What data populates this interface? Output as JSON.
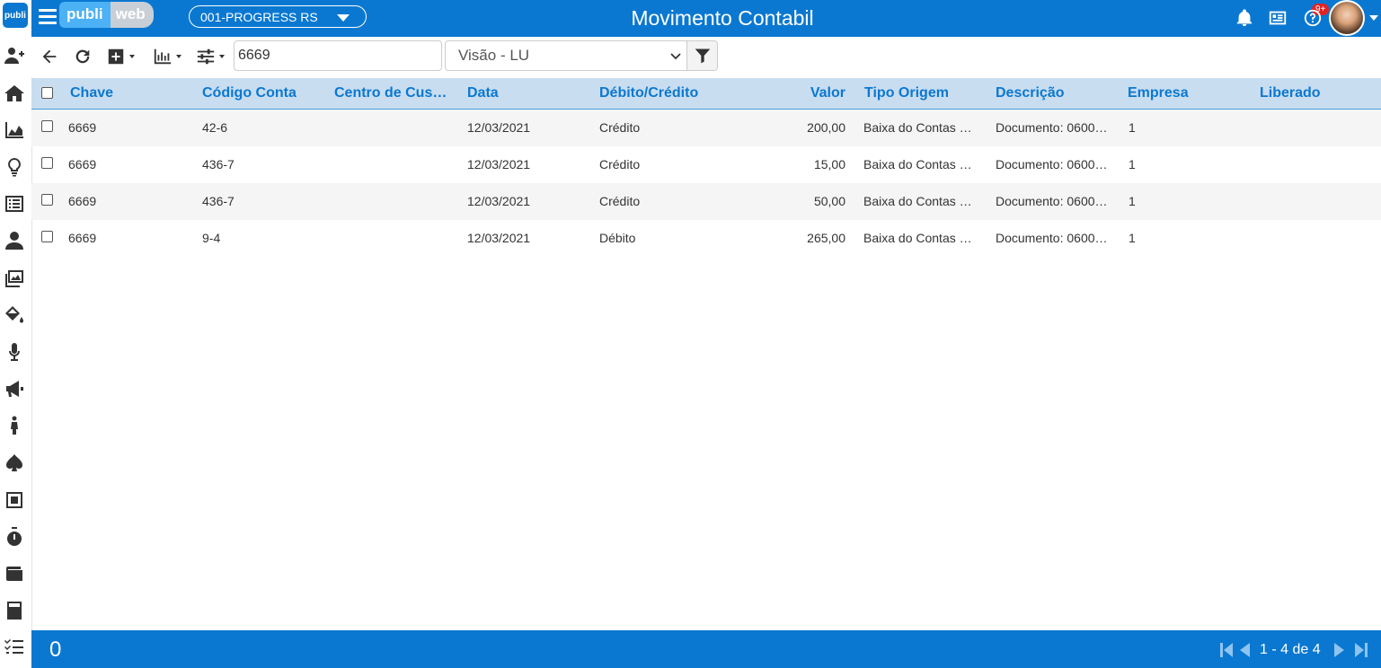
{
  "app": {
    "logo_mini": "publi",
    "brand_left": "publi",
    "brand_right": "web",
    "company": "001-PROGRESS RS",
    "title": "Movimento Contabil",
    "notif_badge": "9+"
  },
  "toolbar": {
    "search_value": "6669",
    "view_label": "Visão - LU"
  },
  "table": {
    "columns": [
      "Chave",
      "Código Conta",
      "Centro de Cus…",
      "Data",
      "Débito/Crédito",
      "Valor",
      "Tipo Origem",
      "Descrição",
      "Empresa",
      "Liberado"
    ],
    "rows": [
      [
        "6669",
        "42-6",
        "",
        "12/03/2021",
        "Crédito",
        "200,00",
        "Baixa do Contas …",
        "Documento: 0600…",
        "1",
        ""
      ],
      [
        "6669",
        "436-7",
        "",
        "12/03/2021",
        "Crédito",
        "15,00",
        "Baixa do Contas …",
        "Documento: 0600…",
        "1",
        ""
      ],
      [
        "6669",
        "436-7",
        "",
        "12/03/2021",
        "Crédito",
        "50,00",
        "Baixa do Contas …",
        "Documento: 0600…",
        "1",
        ""
      ],
      [
        "6669",
        "9-4",
        "",
        "12/03/2021",
        "Débito",
        "265,00",
        "Baixa do Contas …",
        "Documento: 0600…",
        "1",
        ""
      ]
    ]
  },
  "footer": {
    "selected_count": "0",
    "page_info": "1 - 4 de 4"
  },
  "colors": {
    "primary": "#0a78d1",
    "header_bg": "#c9ddf1",
    "row_alt": "#f5f5f5"
  },
  "sidebar_icons": [
    "add-user-icon",
    "home-icon",
    "area-chart-icon",
    "lightbulb-icon",
    "list-icon",
    "user-tie-icon",
    "images-icon",
    "paint-bucket-icon",
    "microphone-icon",
    "megaphone-icon",
    "person-icon",
    "spade-icon",
    "square-icon",
    "stopwatch-icon",
    "wallet-icon",
    "calculator-icon",
    "checklist-icon"
  ]
}
